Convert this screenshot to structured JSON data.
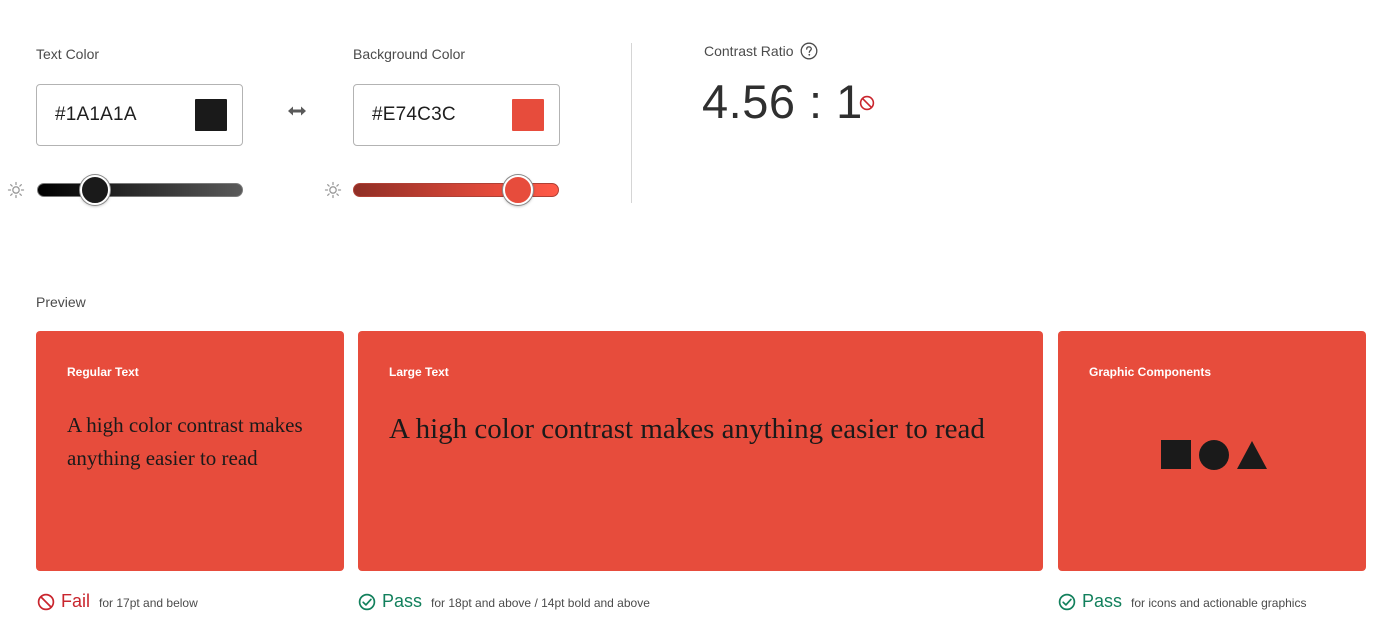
{
  "text_color": {
    "label": "Text Color",
    "hex": "#1A1A1A",
    "swatch": "#1A1A1A",
    "brightness_level": 0.28
  },
  "swap_icon": "swap-arrows-icon",
  "background_color": {
    "label": "Background Color",
    "hex": "#E74C3C",
    "swatch": "#E74C3C",
    "brightness_level": 0.8
  },
  "contrast": {
    "label": "Contrast Ratio",
    "help_icon": "help-icon",
    "value": "4.56 : 1",
    "status_icon": "fail-icon",
    "status_color": "#c9252d"
  },
  "preview": {
    "label": "Preview",
    "regular": {
      "title": "Regular Text",
      "sample": "A high color contrast makes anything easier to read"
    },
    "large": {
      "title": "Large Text",
      "sample": "A high color contrast makes anything easier to read"
    },
    "graphic": {
      "title": "Graphic Components",
      "shapes": [
        "square-shape",
        "circle-shape",
        "triangle-shape"
      ]
    }
  },
  "results": {
    "regular": {
      "status": "Fail",
      "note": "for 17pt and below",
      "color": "#c9252d",
      "icon": "fail-icon"
    },
    "large": {
      "status": "Pass",
      "note": "for 18pt and above / 14pt bold and above",
      "color": "#12805c",
      "icon": "check-circle-icon"
    },
    "graphic": {
      "status": "Pass",
      "note": "for icons and actionable graphics",
      "color": "#12805c",
      "icon": "check-circle-icon"
    }
  }
}
